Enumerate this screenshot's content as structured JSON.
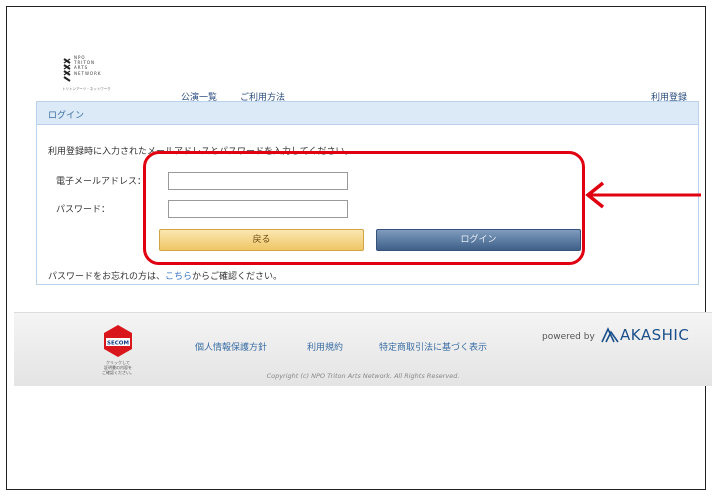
{
  "header": {
    "logo_lines": [
      "NPO",
      "TRITON",
      "ARTS",
      "NETWORK"
    ],
    "logo_sub": "トリトンアーツ・ネットワーク",
    "nav": [
      {
        "label": "公演一覧"
      },
      {
        "label": "ご利用方法"
      }
    ],
    "register": "利用登録"
  },
  "panel": {
    "title": "ログイン",
    "intro": "利用登録時に入力されたメールアドレスとパスワードを入力してください。",
    "email_label": "電子メールアドレス：",
    "email_value": "",
    "password_label": "パスワード：",
    "password_value": "",
    "back_button": "戻る",
    "login_button": "ログイン",
    "forgot_pre": "パスワードをお忘れの方は、",
    "forgot_link": "こちら",
    "forgot_post": "からご確認ください。"
  },
  "annotation": {
    "color": "#e0000f"
  },
  "footer": {
    "secom_text": [
      "クリックして",
      "証明書の内容を",
      "ご確認ください。"
    ],
    "links": [
      {
        "label": "個人情報保護方針"
      },
      {
        "label": "利用規約"
      },
      {
        "label": "特定商取引法に基づく表示"
      }
    ],
    "powered_by": "powered by",
    "brand": "AKASHIC",
    "copyright": "Copyright (c) NPO Triton Arts Network. All Rights Reserved."
  }
}
